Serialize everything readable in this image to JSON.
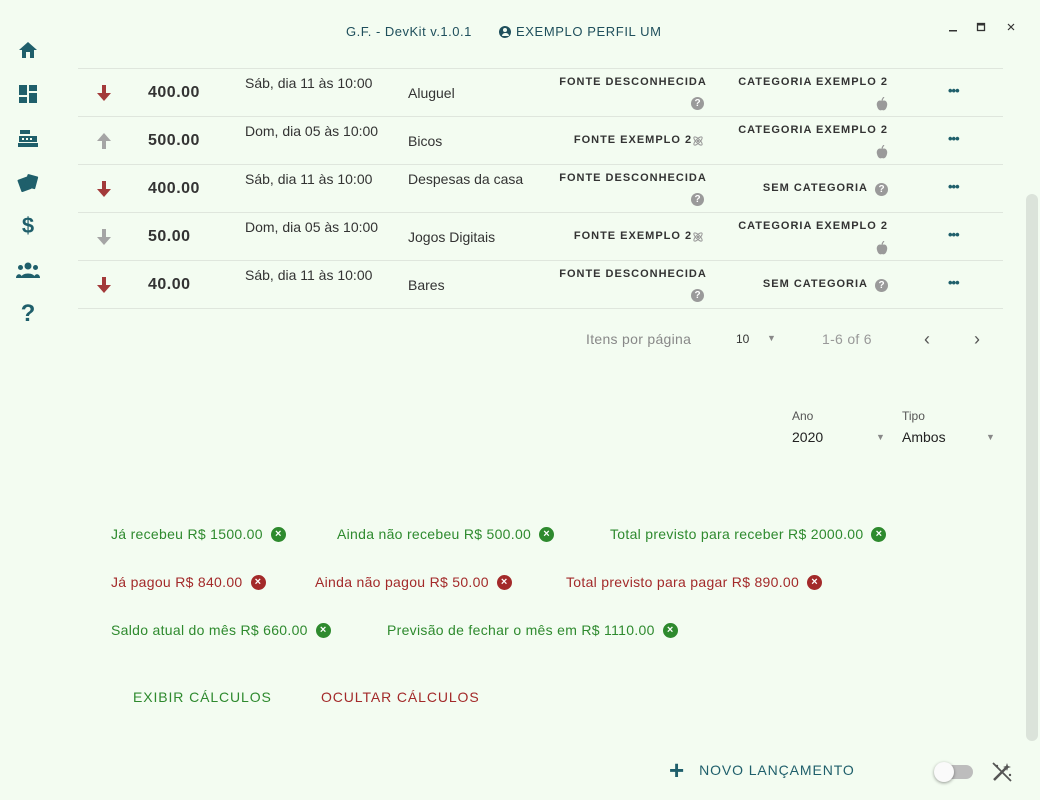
{
  "window": {
    "app_title": "G.F. - DevKit v.1.0.1",
    "profile_name": "EXEMPLO PERFIL UM",
    "profile_icon": "account-circle-icon",
    "controls": {
      "minimize": "▬",
      "maximize": "□",
      "close": "×"
    }
  },
  "sidebar": {
    "items": [
      {
        "name": "home",
        "icon": "home-icon"
      },
      {
        "name": "dashboard",
        "icon": "dashboard-icon"
      },
      {
        "name": "cash-register",
        "icon": "cash-register-icon"
      },
      {
        "name": "cards",
        "icon": "cards-icon"
      },
      {
        "name": "money",
        "icon": "dollar-icon"
      },
      {
        "name": "users",
        "icon": "users-icon"
      },
      {
        "name": "help",
        "icon": "help-icon"
      }
    ]
  },
  "table": {
    "rows": [
      {
        "direction": "down",
        "arrow_color": "#a33a3a",
        "amount": "400.00",
        "date": "Sáb, dia 11 às 10:00",
        "description": "Aluguel",
        "source": "FONTE DESCONHECIDA",
        "source_icon": "question-icon",
        "category": "CATEGORIA EXEMPLO 2",
        "category_icon": "apple-icon",
        "more": "•••"
      },
      {
        "direction": "up",
        "arrow_color": "#a5a5a5",
        "amount": "500.00",
        "date": "Dom, dia 05 às 10:00",
        "description": "Bicos",
        "source": "FONTE EXEMPLO 2",
        "source_icon": "atom-icon",
        "category": "CATEGORIA EXEMPLO 2",
        "category_icon": "apple-icon",
        "more": "•••"
      },
      {
        "direction": "down",
        "arrow_color": "#a33a3a",
        "amount": "400.00",
        "date": "Sáb, dia 11 às 10:00",
        "description": "Despesas da casa",
        "source": "FONTE DESCONHECIDA",
        "source_icon": "question-icon",
        "category": "SEM CATEGORIA",
        "category_icon": "question-icon",
        "more": "•••"
      },
      {
        "direction": "down",
        "arrow_color": "#a5a5a5",
        "amount": "50.00",
        "date": "Dom, dia 05 às 10:00",
        "description": "Jogos Digitais",
        "source": "FONTE EXEMPLO 2",
        "source_icon": "atom-icon",
        "category": "CATEGORIA EXEMPLO 2",
        "category_icon": "apple-icon",
        "more": "•••"
      },
      {
        "direction": "down",
        "arrow_color": "#a33a3a",
        "amount": "40.00",
        "date": "Sáb, dia 11 às 10:00",
        "description": "Bares",
        "source": "FONTE DESCONHECIDA",
        "source_icon": "question-icon",
        "category": "SEM CATEGORIA",
        "category_icon": "question-icon",
        "more": "•••"
      }
    ]
  },
  "pagination": {
    "items_per_page_label": "Itens por página",
    "items_per_page": "10",
    "range": "1-6 of 6",
    "prev": "‹",
    "next": "›"
  },
  "filters": {
    "year_label": "Ano",
    "year_value": "2020",
    "type_label": "Tipo",
    "type_value": "Ambos"
  },
  "summary": {
    "received": "Já recebeu R$ 1500.00",
    "not_received": "Ainda não recebeu R$ 500.00",
    "total_receive": "Total previsto para receber R$ 2000.00",
    "paid": "Já pagou R$ 840.00",
    "not_paid": "Ainda não pagou R$ 50.00",
    "total_pay": "Total previsto para pagar R$ 890.00",
    "balance": "Saldo atual do mês R$ 660.00",
    "forecast": "Previsão de fechar o mês em R$ 1110.00",
    "close_glyph": "×",
    "positive_color": "#2e8a2e",
    "negative_color": "#a32a2a"
  },
  "actions": {
    "show_calcs": "EXIBIR CÁLCULOS",
    "hide_calcs": "OCULTAR CÁLCULOS",
    "new_entry": "NOVO LANÇAMENTO",
    "new_entry_glyph": "+"
  },
  "theme": {
    "accent": "#1f5f6b",
    "background": "#f3fcf1"
  }
}
